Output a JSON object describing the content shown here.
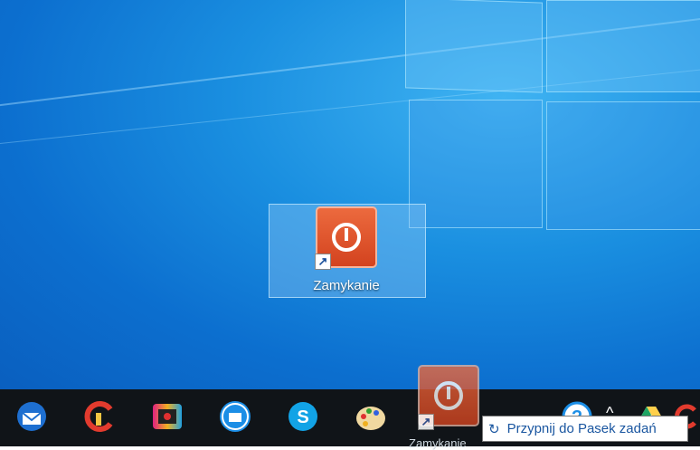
{
  "desktop": {
    "shortcut": {
      "label": "Zamykanie",
      "icon": "power-icon"
    }
  },
  "drag_preview": {
    "label": "Zamykanie",
    "icon": "power-icon"
  },
  "tooltip": {
    "icon": "pin-icon",
    "text": "Przypnij do Pasek zadań"
  },
  "taskbar": {
    "apps": [
      {
        "name": "thunderbird-icon"
      },
      {
        "name": "ccleaner-icon"
      },
      {
        "name": "screen-recorder-icon"
      },
      {
        "name": "video-editor-icon"
      },
      {
        "name": "skype-icon"
      },
      {
        "name": "paint-icon"
      }
    ],
    "tray": {
      "help_icon": "help-icon",
      "chevron": "^",
      "drive_icon": "google-drive-icon",
      "extra_icon": "ccleaner-tray-icon"
    }
  },
  "colors": {
    "desktop": "#1a8fe0",
    "taskbar": "#101418",
    "app_icon": "#d94a25",
    "tooltip_text": "#1a56a0"
  }
}
